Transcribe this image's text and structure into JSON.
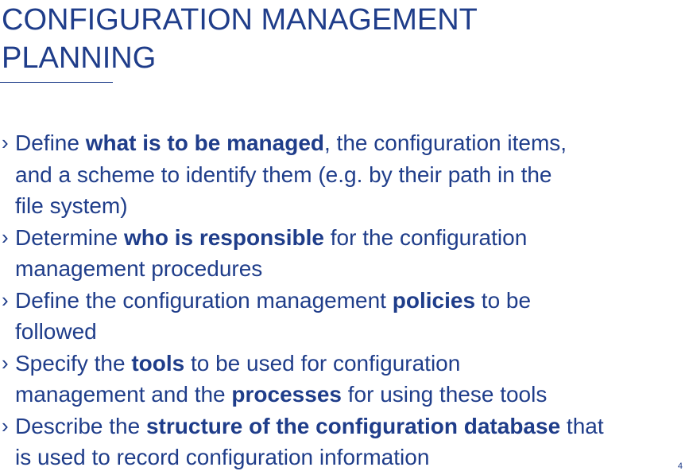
{
  "slide": {
    "title_lines": [
      "CONFIGURATION MANAGEMENT",
      "PLANNING"
    ],
    "bullet_marker": "›",
    "bullets": [
      {
        "lines": [
          [
            {
              "t": "Define ",
              "b": false
            },
            {
              "t": "what is to be managed",
              "b": true
            },
            {
              "t": ", the configuration items,",
              "b": false
            }
          ],
          [
            {
              "t": "and a scheme to identify them (e.g. by their path in the",
              "b": false
            }
          ],
          [
            {
              "t": "file system)",
              "b": false
            }
          ]
        ]
      },
      {
        "lines": [
          [
            {
              "t": "Determine ",
              "b": false
            },
            {
              "t": "who is responsible",
              "b": true
            },
            {
              "t": " for the configuration",
              "b": false
            }
          ],
          [
            {
              "t": "management procedures",
              "b": false
            }
          ]
        ]
      },
      {
        "lines": [
          [
            {
              "t": "Define the configuration management ",
              "b": false
            },
            {
              "t": "policies",
              "b": true
            },
            {
              "t": " to be",
              "b": false
            }
          ],
          [
            {
              "t": "followed",
              "b": false
            }
          ]
        ]
      },
      {
        "lines": [
          [
            {
              "t": "Specify the ",
              "b": false
            },
            {
              "t": "tools",
              "b": true
            },
            {
              "t": " to be used for configuration",
              "b": false
            }
          ],
          [
            {
              "t": "management and the ",
              "b": false
            },
            {
              "t": "processes",
              "b": true
            },
            {
              "t": " for using these tools",
              "b": false
            }
          ]
        ]
      },
      {
        "lines": [
          [
            {
              "t": "Describe the ",
              "b": false
            },
            {
              "t": "structure of the configuration database",
              "b": true
            },
            {
              "t": " that",
              "b": false
            }
          ],
          [
            {
              "t": "is used to record configuration information",
              "b": false
            }
          ]
        ]
      }
    ],
    "page_number": "4"
  },
  "colors": {
    "text": "#1f3d8a",
    "background": "#ffffff"
  }
}
